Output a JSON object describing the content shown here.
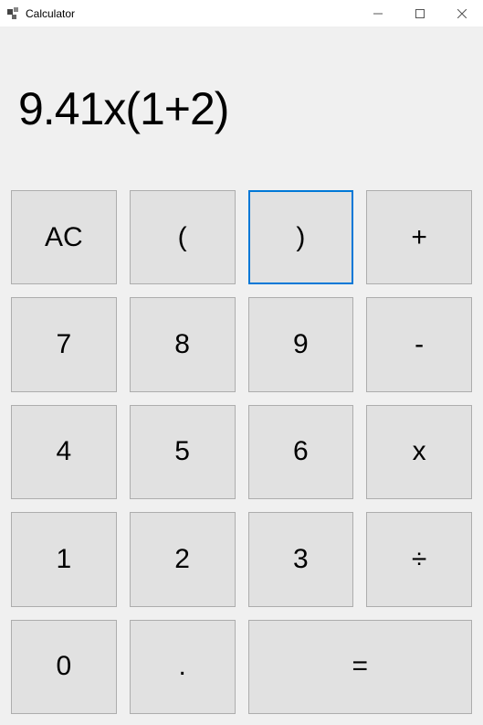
{
  "window": {
    "title": "Calculator"
  },
  "display": {
    "expression": "9.41x(1+2)"
  },
  "buttons": {
    "ac": "AC",
    "lparen": "(",
    "rparen": ")",
    "plus": "+",
    "seven": "7",
    "eight": "8",
    "nine": "9",
    "minus": "-",
    "four": "4",
    "five": "5",
    "six": "6",
    "multiply": "x",
    "one": "1",
    "two": "2",
    "three": "3",
    "divide": "÷",
    "zero": "0",
    "dot": ".",
    "equals": "="
  },
  "focused_button": "rparen"
}
